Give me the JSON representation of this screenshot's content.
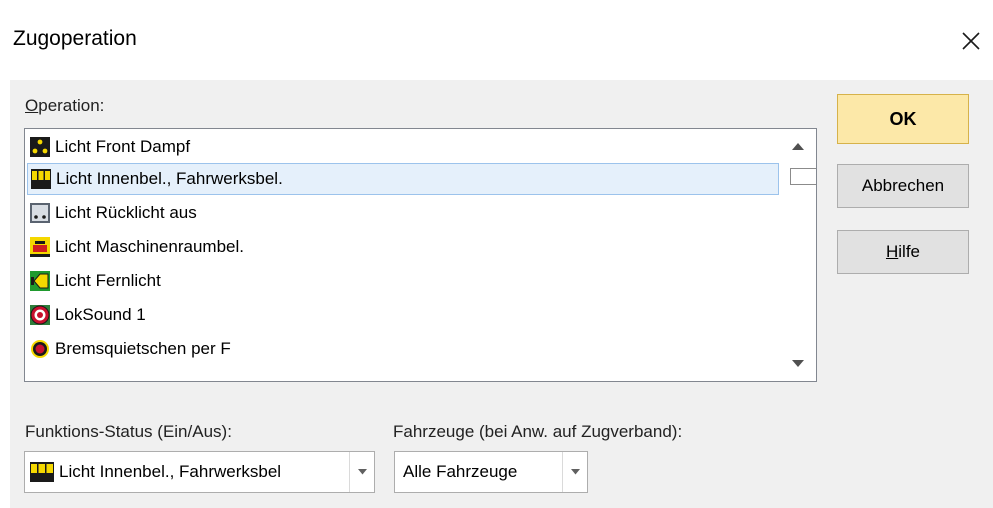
{
  "dialog": {
    "title": "Zugoperation"
  },
  "operation": {
    "label_accel": "O",
    "label_rest": "peration:",
    "items": [
      {
        "label": "Licht Front Dampf",
        "icon": "front-light-steam-icon",
        "selected": false
      },
      {
        "label": "Licht Innenbel., Fahrwerksbel.",
        "icon": "interior-light-icon",
        "selected": true
      },
      {
        "label": "Licht Rücklicht aus",
        "icon": "rear-light-off-icon",
        "selected": false
      },
      {
        "label": "Licht Maschinenraumbel.",
        "icon": "engine-room-light-icon",
        "selected": false
      },
      {
        "label": "Licht Fernlicht",
        "icon": "high-beam-icon",
        "selected": false
      },
      {
        "label": "LokSound 1",
        "icon": "loksound-icon",
        "selected": false
      },
      {
        "label": "Bremsquietschen per F",
        "icon": "brake-squeal-icon",
        "selected": false
      }
    ]
  },
  "buttons": {
    "ok": "OK",
    "cancel": "Abbrechen",
    "help_accel": "H",
    "help_rest": "ilfe"
  },
  "function_status": {
    "label": "Funktions-Status (Ein/Aus):",
    "value": "Licht Innenbel., Fahrwerksbel",
    "icon": "interior-light-icon"
  },
  "vehicles": {
    "label": "Fahrzeuge (bei Anw. auf Zugverband):",
    "value": "Alle Fahrzeuge"
  },
  "icons": {
    "close": "close-icon",
    "scroll_up": "arrow-up-icon",
    "scroll_down": "arrow-down-icon",
    "dropdown": "chevron-down-icon"
  },
  "colors": {
    "ok_button": "#fce8a8",
    "selection": "#e5f0fb",
    "selection_border": "#9cc3ec",
    "client_bg": "#f0f0f0"
  }
}
